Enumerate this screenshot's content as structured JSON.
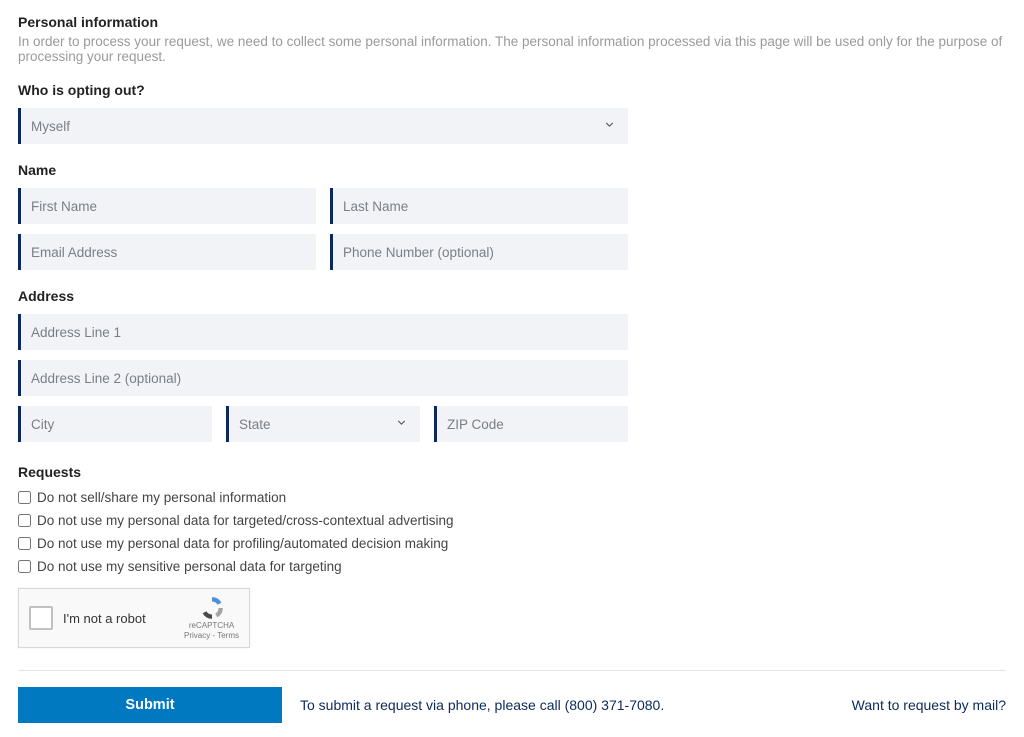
{
  "personal": {
    "title": "Personal information",
    "desc": "In order to process your request, we need to collect some personal information. The personal information processed via this page will be used only for the purpose of processing your request."
  },
  "opting": {
    "label": "Who is opting out?",
    "value": "Myself"
  },
  "name": {
    "label": "Name",
    "first_placeholder": "First Name",
    "last_placeholder": "Last Name",
    "email_placeholder": "Email Address",
    "phone_placeholder": "Phone Number (optional)"
  },
  "address": {
    "label": "Address",
    "line1_placeholder": "Address Line 1",
    "line2_placeholder": "Address Line 2 (optional)",
    "city_placeholder": "City",
    "state_placeholder": "State",
    "zip_placeholder": "ZIP Code"
  },
  "requests": {
    "label": "Requests",
    "items": [
      "Do not sell/share my personal information",
      "Do not use my personal data for targeted/cross-contextual advertising",
      "Do not use my personal data for profiling/automated decision making",
      "Do not use my sensitive personal data for targeting"
    ]
  },
  "recaptcha": {
    "label": "I'm not a robot",
    "brand": "reCAPTCHA",
    "terms": "Privacy - Terms"
  },
  "footer": {
    "submit": "Submit",
    "phone_text": "To submit a request via phone, please call (800) 371-7080.",
    "mail_link": "Want to request by mail?"
  }
}
